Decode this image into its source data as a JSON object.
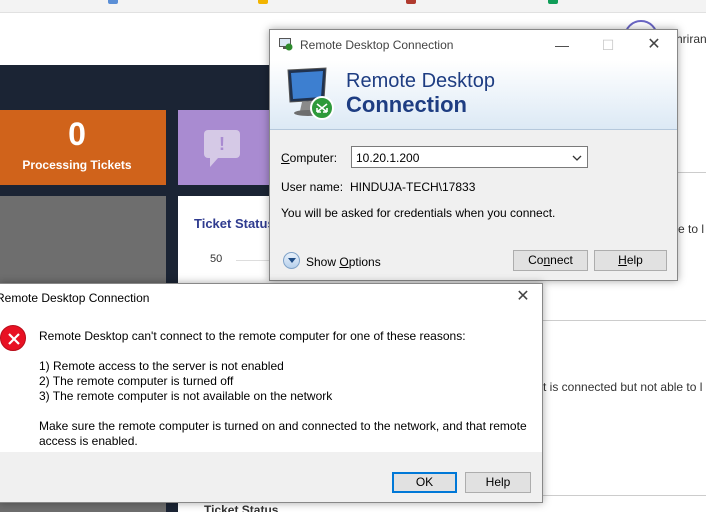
{
  "background": {
    "username_fragment": "hriran",
    "tile_processing": {
      "count": "0",
      "label": "Processing Tickets"
    },
    "tile_alert_icon": "alert-bubble-icon",
    "chart_title": "Ticket Status",
    "chart_tick": "50",
    "chart_title_2": "Ticket Status",
    "text_right_1": "e to l",
    "text_right_2": "t is connected but not able to l"
  },
  "rdp_window": {
    "title": "Remote Desktop Connection",
    "banner_line1": "Remote Desktop",
    "banner_line2": "Connection",
    "computer_label_u": "C",
    "computer_label_rest": "omputer:",
    "computer_value": "10.20.1.200",
    "username_label": "User name:",
    "username_value": "HINDUJA-TECH\\17833",
    "credentials_note": "You will be asked for credentials when you connect.",
    "show_options_a": "Show ",
    "show_options_u": "O",
    "show_options_b": "ptions",
    "connect_a": "Co",
    "connect_u": "n",
    "connect_b": "nect",
    "help_u": "H",
    "help_b": "elp"
  },
  "error_dialog": {
    "title": "Remote Desktop Connection",
    "message": "Remote Desktop can't connect to the remote computer for one of these reasons:",
    "reason_1": "1) Remote access to the server is not enabled",
    "reason_2": "2) The remote computer is turned off",
    "reason_3": "3) The remote computer is not available on the network",
    "advice_line1": "Make sure the remote computer is turned on and connected to the network, and that remote",
    "advice_line2": "access is enabled.",
    "ok_label": "OK",
    "help_label": "Help"
  },
  "colors": {
    "error_red": "#e81123",
    "banner_blue": "#1e3d82",
    "orange_tile": "#d0631b",
    "purple_tile": "#a98bd1",
    "dark_bg": "#1b2434"
  }
}
